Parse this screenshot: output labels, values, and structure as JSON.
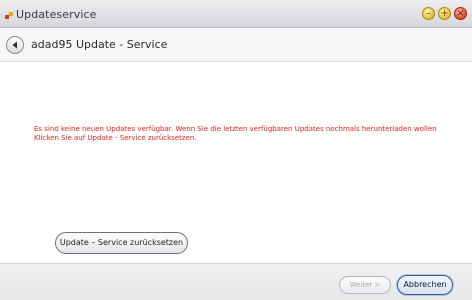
{
  "window": {
    "title": "Updateservice",
    "controls": [
      "minimize",
      "maximize",
      "close"
    ]
  },
  "navbar": {
    "back_icon": "back-arrow-icon",
    "title": "adad95 Update - Service"
  },
  "content": {
    "message": "Es sind keine neuen Updates verfügbar. Wenn Sie die letzten verfügbaren Updates nochmals herunterladen wollen Klicken Sie auf Update - Service zurücksetzen.",
    "message_color": "#e0261c",
    "reset_button_label": "Update – Service zurücksetzen"
  },
  "footer": {
    "next_label": "Weiter >",
    "next_enabled": false,
    "cancel_label": "Abbrechen"
  }
}
